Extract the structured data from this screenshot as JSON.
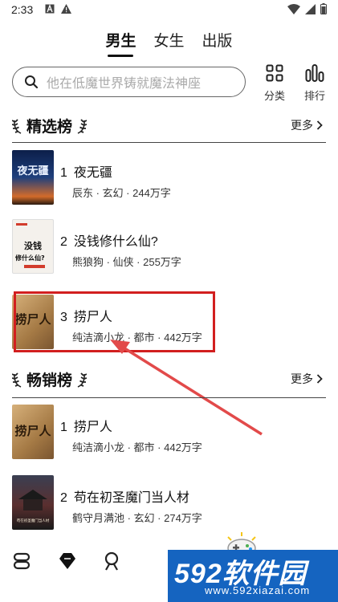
{
  "status": {
    "time": "2:33"
  },
  "tabs": [
    {
      "label": "男生",
      "active": true
    },
    {
      "label": "女生",
      "active": false
    },
    {
      "label": "出版",
      "active": false
    }
  ],
  "search": {
    "placeholder": "他在低魔世界铸就魔法神座"
  },
  "actions": {
    "category": "分类",
    "ranking": "排行"
  },
  "sections": [
    {
      "title": "精选榜",
      "more": "更多",
      "books": [
        {
          "rank": "1",
          "title": "夜无疆",
          "meta": "辰东 · 玄幻 · 244万字"
        },
        {
          "rank": "2",
          "title": "没钱修什么仙?",
          "meta": "熊狼狗 · 仙侠 · 255万字"
        },
        {
          "rank": "3",
          "title": "捞尸人",
          "meta": "纯洁滴小龙 · 都市 · 442万字"
        }
      ]
    },
    {
      "title": "畅销榜",
      "more": "更多",
      "books": [
        {
          "rank": "1",
          "title": "捞尸人",
          "meta": "纯洁滴小龙 · 都市 · 442万字"
        },
        {
          "rank": "2",
          "title": "苟在初圣魔门当人材",
          "meta": "鹤守月满池 · 玄幻 · 274万字"
        }
      ]
    }
  ],
  "covers": {
    "c1": "夜无疆",
    "c2a": "没钱",
    "c2b": "修什么仙?",
    "c3": "捞尸人",
    "c5": "苟在初圣魔门当人材"
  },
  "watermark": {
    "big": "592软件园",
    "small": "www.592xiazai.com"
  },
  "colors": {
    "annotation": "#d21f1f",
    "watermark_bg": "#1564c0"
  }
}
